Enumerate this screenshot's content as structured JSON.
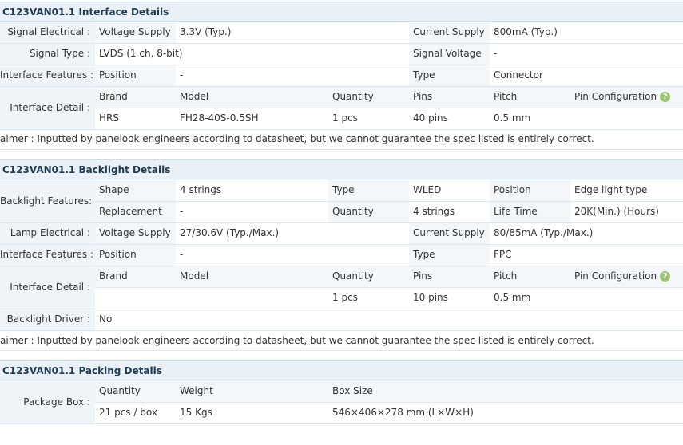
{
  "interface": {
    "title": "C123VAN01.1 Interface Details",
    "signal_electrical_label": "Signal Electrical :",
    "voltage_supply_label": "Voltage Supply",
    "voltage_supply_value": "3.3V (Typ.)",
    "current_supply_label": "Current Supply",
    "current_supply_value": "800mA (Typ.)",
    "signal_type_label": "Signal Type :",
    "signal_type_value": "LVDS (1 ch, 8-bit)",
    "signal_voltage_label": "Signal Voltage",
    "signal_voltage_value": "-",
    "features_label": "Interface Features :",
    "position_label": "Position",
    "position_value": "-",
    "type_label": "Type",
    "type_value": "Connector",
    "detail_label": "Interface Detail :",
    "headers": [
      "Brand",
      "Model",
      "Quantity",
      "Pins",
      "Pitch",
      "Pin Configuration"
    ],
    "row": [
      "HRS",
      "FH28-40S-0.5SH",
      "1 pcs",
      "40 pins",
      "0.5 mm",
      ""
    ],
    "help_glyph": "?",
    "disclaimer": "aimer : Inputted by panelook engineers according to datasheet, but we cannot guarantee the spec listed is entirely correct."
  },
  "backlight": {
    "title": "C123VAN01.1 Backlight Details",
    "features_label": "Backlight Features:",
    "shape_label": "Shape",
    "shape_value": "4 strings",
    "type_label": "Type",
    "type_value": "WLED",
    "position_label": "Position",
    "position_value": "Edge light type",
    "replacement_label": "Replacement",
    "replacement_value": "-",
    "quantity_label": "Quantity",
    "quantity_value": "4 strings",
    "life_time_label": "Life Time",
    "life_time_value": "20K(Min.) (Hours)",
    "lamp_electrical_label": "Lamp Electrical :",
    "voltage_supply_label": "Voltage Supply",
    "voltage_supply_value": "27/30.6V (Typ./Max.)",
    "current_supply_label": "Current Supply",
    "current_supply_value": "80/85mA (Typ./Max.)",
    "if_features_label": "Interface Features :",
    "if_position_label": "Position",
    "if_position_value": "-",
    "if_type_label": "Type",
    "if_type_value": "FPC",
    "detail_label": "Interface Detail :",
    "headers": [
      "Brand",
      "Model",
      "Quantity",
      "Pins",
      "Pitch",
      "Pin Configuration"
    ],
    "row": [
      "",
      "",
      "1 pcs",
      "10 pins",
      "0.5 mm",
      ""
    ],
    "help_glyph": "?",
    "driver_label": "Backlight Driver :",
    "driver_value": "No",
    "disclaimer": "aimer : Inputted by panelook engineers according to datasheet, but we cannot guarantee the spec listed is entirely correct."
  },
  "packing": {
    "title": "C123VAN01.1 Packing Details",
    "package_box_label": "Package Box :",
    "headers": [
      "Quantity",
      "Weight",
      "Box Size"
    ],
    "values": [
      "21 pcs / box",
      "15 Kgs",
      "546×406×278 mm (L×W×H)"
    ]
  },
  "colors": {
    "header_bg": "#eaf1f6",
    "label_bg": "#eef4f8",
    "title_text": "#1f3a52",
    "help_icon": "#9cc46f"
  }
}
